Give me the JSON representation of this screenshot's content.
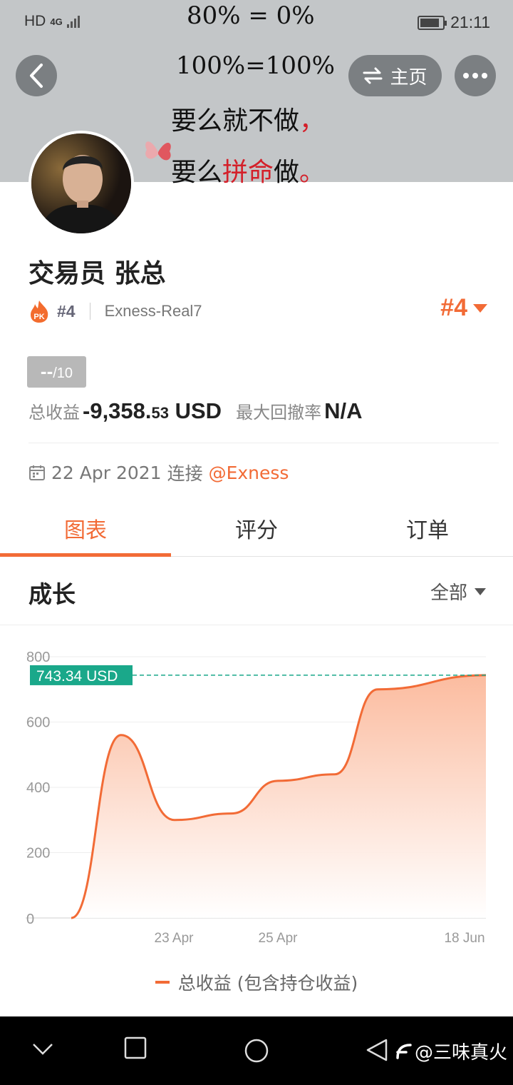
{
  "status_bar": {
    "network": "HD",
    "signal": "4G",
    "time": "21:11"
  },
  "banner": {
    "line1": "80% = 0%",
    "line2": "100%=100%",
    "line3_main": "要么就不做",
    "line3_punct": "，",
    "line4_a": "要么",
    "line4_red": "拼命",
    "line4_b": "做",
    "line4_punct": "。"
  },
  "header": {
    "home_label": "主页"
  },
  "profile": {
    "name": "交易员  张总",
    "rank_small": "#4",
    "account": "Exness-Real7",
    "rank_big": "#4",
    "score_value": "--",
    "score_max": "/10",
    "total_profit_label": "总收益",
    "total_profit_main": "-9,358.",
    "total_profit_cents": "53",
    "total_profit_currency": " USD",
    "max_drawdown_label": "最大回撤率",
    "max_drawdown_value": "N/A",
    "connect_date": "22 Apr 2021",
    "connect_text": "连接",
    "connect_broker": "@Exness"
  },
  "tabs": [
    {
      "label": "图表",
      "active": true
    },
    {
      "label": "评分",
      "active": false
    },
    {
      "label": "订单",
      "active": false
    }
  ],
  "section": {
    "title": "成长",
    "range": "全部"
  },
  "chart_data": {
    "type": "area",
    "series": [
      {
        "name": "总收益 (包含持仓收益)",
        "points": [
          [
            "start",
            0
          ],
          [
            "",
            560
          ],
          [
            "",
            300
          ],
          [
            "",
            320
          ],
          [
            "",
            420
          ],
          [
            "",
            440
          ],
          [
            "",
            700
          ],
          [
            "18 Jun",
            743.34
          ]
        ]
      }
    ],
    "x_tick_labels": [
      "23 Apr",
      "25 Apr",
      "18 Jun"
    ],
    "y_ticks": [
      0,
      200,
      400,
      600,
      800
    ],
    "ylim": [
      0,
      800
    ],
    "current_value_label": "743.34 USD",
    "current_value": 743.34,
    "legend": "总收益 (包含持仓收益)",
    "colors": {
      "line": "#f26b36",
      "fill": "#fbc3a9",
      "marker": "#1aa88a"
    },
    "grid": true
  },
  "navbar": {
    "watermark": "@三味真火"
  }
}
